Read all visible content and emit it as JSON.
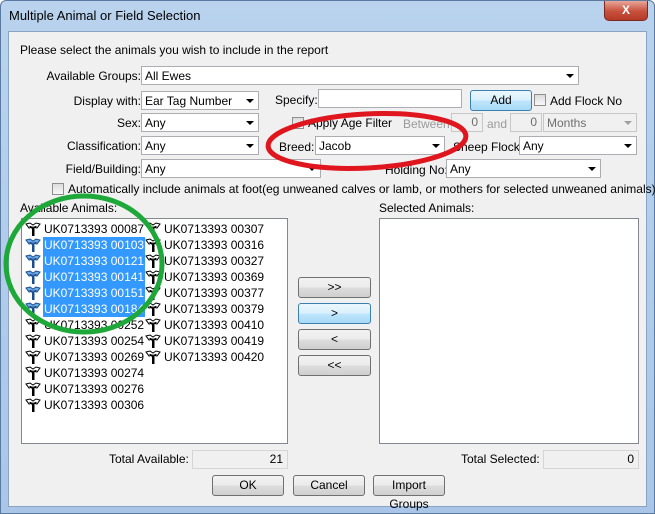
{
  "window": {
    "title": "Multiple Animal or Field Selection",
    "close_label": "X"
  },
  "instruction": "Please select the animals you wish to include in the report",
  "filters": {
    "available_groups": {
      "label": "Available Groups:",
      "value": "All Ewes"
    },
    "display_with": {
      "label": "Display with:",
      "value": "Ear Tag Number"
    },
    "specify": {
      "label": "Specify:",
      "value": ""
    },
    "add_button": "Add",
    "add_flock_no": {
      "label": "Add Flock No",
      "checked": false
    },
    "sex": {
      "label": "Sex:",
      "value": "Any"
    },
    "apply_age_filter": {
      "label": "Apply Age Filter",
      "checked": false
    },
    "between_label": "Between",
    "age_from": "0",
    "and_label": "and",
    "age_to": "0",
    "age_unit": "Months",
    "classification": {
      "label": "Classification:",
      "value": "Any"
    },
    "breed": {
      "label": "Breed:",
      "value": "Jacob"
    },
    "sheep_flock": {
      "label": "Sheep Flock:",
      "value": "Any"
    },
    "field_building": {
      "label": "Field/Building:",
      "value": "Any"
    },
    "holding_no": {
      "label": "Holding No:",
      "value": "Any"
    },
    "auto_include": {
      "label": "Automatically include animals at foot(eg unweaned calves or lamb, or mothers for selected unweaned animals)",
      "checked": false
    }
  },
  "available": {
    "label": "Available Animals:",
    "items": [
      {
        "tag": "UK0713393 00087",
        "selected": false
      },
      {
        "tag": "UK0713393 00103",
        "selected": true
      },
      {
        "tag": "UK0713393 00121",
        "selected": true
      },
      {
        "tag": "UK0713393 00141",
        "selected": true
      },
      {
        "tag": "UK0713393 00151",
        "selected": true
      },
      {
        "tag": "UK0713393 00184",
        "selected": true
      },
      {
        "tag": "UK0713393 00252",
        "selected": false
      },
      {
        "tag": "UK0713393 00254",
        "selected": false
      },
      {
        "tag": "UK0713393 00269",
        "selected": false
      },
      {
        "tag": "UK0713393 00274",
        "selected": false
      },
      {
        "tag": "UK0713393 00276",
        "selected": false
      },
      {
        "tag": "UK0713393 00306",
        "selected": false
      },
      {
        "tag": "UK0713393 00307",
        "selected": false
      },
      {
        "tag": "UK0713393 00316",
        "selected": false
      },
      {
        "tag": "UK0713393 00327",
        "selected": false
      },
      {
        "tag": "UK0713393 00369",
        "selected": false
      },
      {
        "tag": "UK0713393 00377",
        "selected": false
      },
      {
        "tag": "UK0713393 00379",
        "selected": false
      },
      {
        "tag": "UK0713393 00410",
        "selected": false
      },
      {
        "tag": "UK0713393 00419",
        "selected": false
      },
      {
        "tag": "UK0713393 00420",
        "selected": false
      }
    ],
    "total_label": "Total Available:",
    "total": "21"
  },
  "transfer_buttons": {
    "add_all": ">>",
    "add_one": ">",
    "remove_one": "<",
    "remove_all": "<<"
  },
  "selected": {
    "label": "Selected Animals:",
    "items": [],
    "total_label": "Total Selected:",
    "total": "0"
  },
  "footer": {
    "ok": "OK",
    "cancel": "Cancel",
    "import_groups": "Import Groups"
  },
  "colors": {
    "selection": "#3399ff",
    "annotation_red": "#e0161e",
    "annotation_green": "#1fa83a"
  }
}
